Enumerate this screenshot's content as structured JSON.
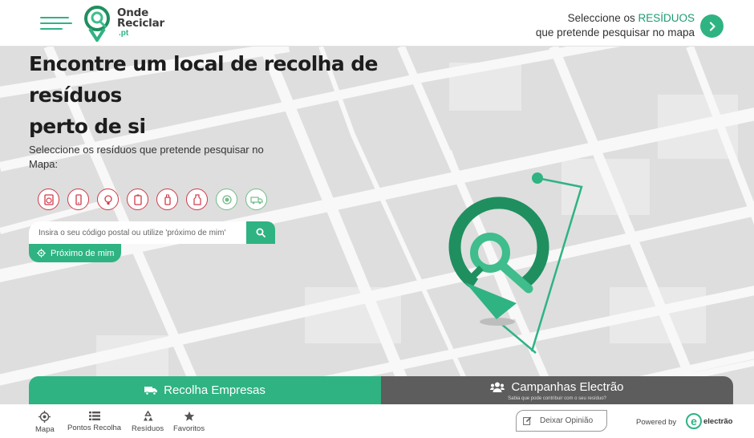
{
  "header": {
    "logo_line1": "Onde",
    "logo_line2": "Reciclar",
    "logo_domain": ".pt",
    "prompt_prefix": "Seleccione os",
    "prompt_highlight": "RESÍDUOS",
    "prompt_line2": "que pretende pesquisar no mapa"
  },
  "hero": {
    "title_line1": "Encontre um local de recolha de",
    "title_line2": "resíduos",
    "title_line3": "perto de si",
    "subtitle": "Seleccione os resíduos que pretende pesquisar no Mapa:"
  },
  "waste_icons": [
    "appliance-icon",
    "phone-icon",
    "lamp-icon",
    "battery-icon",
    "spray-icon",
    "oil-bottle-icon",
    "glass-icon",
    "truck-icon"
  ],
  "search": {
    "placeholder": "Insira o seu código postal ou utilize 'próximo de mim'",
    "near_me_label": "Próximo de mim"
  },
  "panels": {
    "companies_label": "Recolha Empresas",
    "campaigns_label": "Campanhas Electrão",
    "campaigns_sub": "Sabia que pode contribuir com o seu resíduo?"
  },
  "footer": {
    "nav": [
      {
        "label": "Mapa",
        "icon": "target-icon"
      },
      {
        "label": "Pontos Recolha",
        "icon": "list-icon"
      },
      {
        "label": "Resíduos",
        "icon": "recycle-icon"
      },
      {
        "label": "Favoritos",
        "icon": "star-icon"
      }
    ],
    "opinion_label": "Deixar Opinião",
    "powered_by": "Powered by",
    "brand": "electrão"
  },
  "colors": {
    "accent": "#2fb383",
    "accent_dark": "#1f8f5f",
    "waste_icon_border": "#d23a4a",
    "panel_gray": "#5d5d5d",
    "map_roads": "#f7f7f7",
    "map_blocks": "#dcdcdc"
  }
}
